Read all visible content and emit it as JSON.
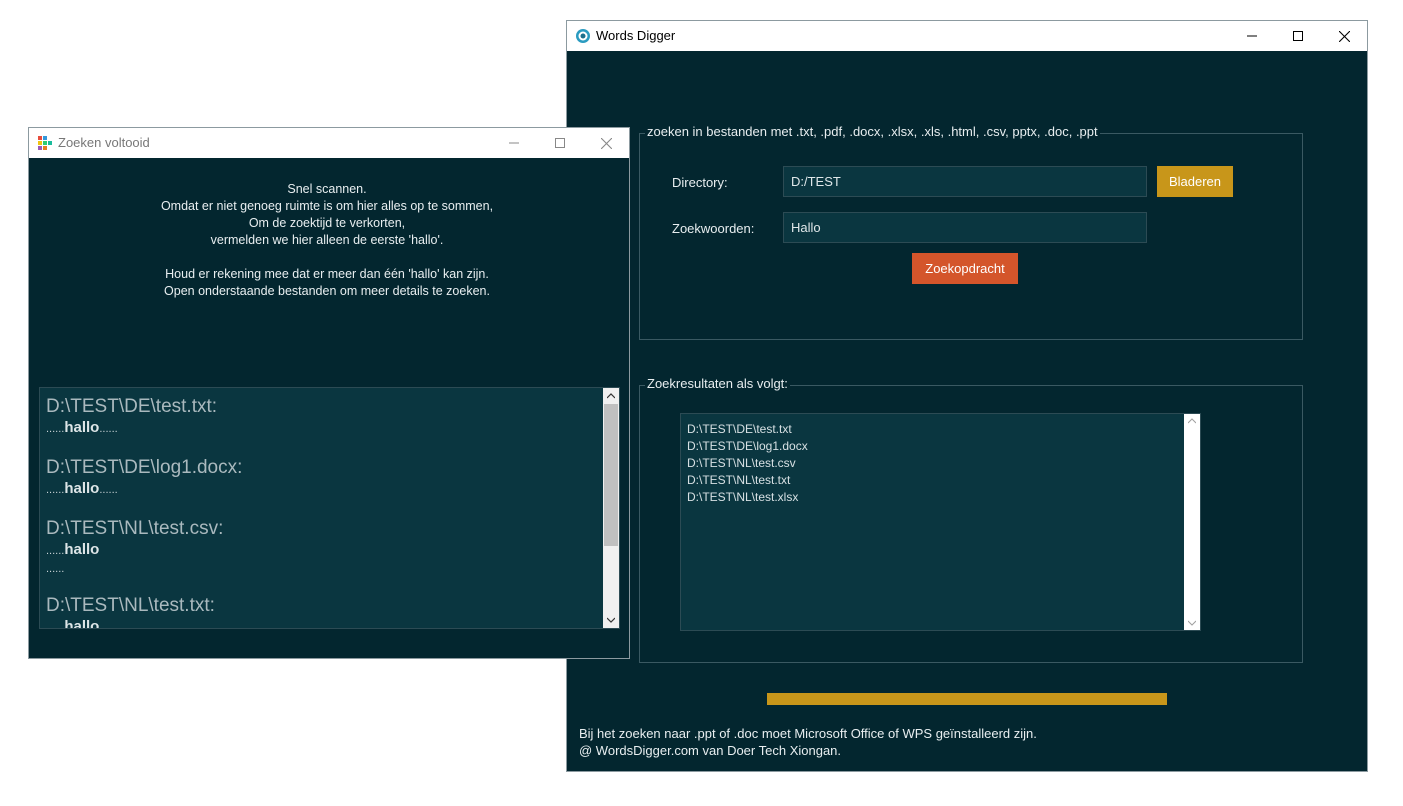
{
  "main_window": {
    "title": "Words Digger",
    "file_types_label": "zoeken in bestanden met .txt, .pdf, .docx, .xlsx, .xls, .html, .csv, pptx, .doc, .ppt",
    "directory_label": "Directory:",
    "directory_value": "D:/TEST",
    "browse_button": "Bladeren",
    "keywords_label": "Zoekwoorden:",
    "keywords_value": "Hallo",
    "search_button": "Zoekopdracht",
    "results_label": "Zoekresultaten als volgt:",
    "results": [
      "D:\\TEST\\DE\\test.txt",
      "D:\\TEST\\DE\\log1.docx",
      "D:\\TEST\\NL\\test.csv",
      "D:\\TEST\\NL\\test.txt",
      "D:\\TEST\\NL\\test.xlsx"
    ],
    "progress": 1.0,
    "footer_line1": "Bij het zoeken naar .ppt of .doc moet Microsoft Office of WPS geïnstalleerd zijn.",
    "footer_line2": "@ WordsDigger.com van Doer Tech Xiongan."
  },
  "dialog": {
    "title": "Zoeken voltooid",
    "message_lines": [
      "Snel scannen.",
      "Omdat er niet genoeg ruimte is om hier alles op te sommen,",
      "Om de zoektijd te verkorten,",
      "vermelden we hier alleen de eerste 'hallo'.",
      "",
      "Houd er rekening mee dat er meer dan één 'hallo' kan zijn.",
      "Open onderstaande bestanden om meer details te zoeken."
    ],
    "entries": [
      {
        "path": "D:\\TEST\\DE\\test.txt:",
        "pre": "......",
        "match": "hallo",
        "post": "......",
        "extra": ""
      },
      {
        "path": "D:\\TEST\\DE\\log1.docx:",
        "pre": "......",
        "match": "hallo",
        "post": "......",
        "extra": ""
      },
      {
        "path": "D:\\TEST\\NL\\test.csv:",
        "pre": "......",
        "match": "hallo",
        "post": "",
        "extra": "......"
      },
      {
        "path": "D:\\TEST\\NL\\test.txt:",
        "pre": "......",
        "match": "hallo",
        "post": "......",
        "extra": ""
      }
    ]
  },
  "colors": {
    "window_bg": "#03262f",
    "accent_gold": "#c8961a",
    "accent_orange": "#d4552b"
  }
}
